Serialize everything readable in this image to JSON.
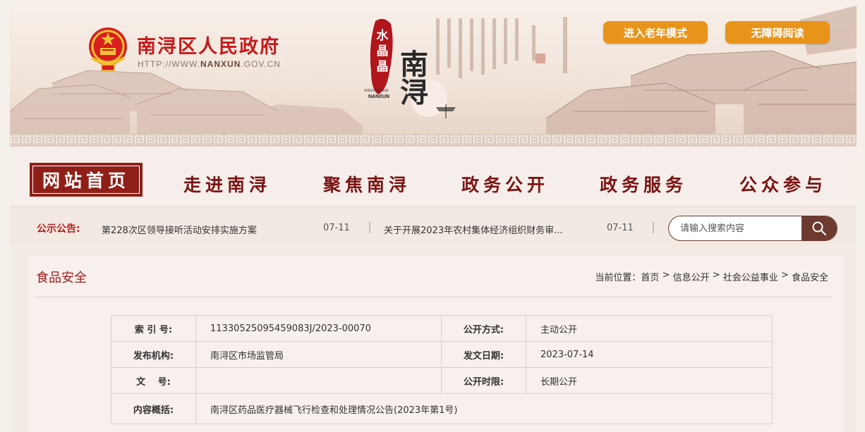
{
  "header": {
    "site_title": "南浔区人民政府",
    "site_url_prefix": "HTTP://WWW.",
    "site_url_domain": "NANXUN",
    "site_url_suffix": ".GOV.CN",
    "logo_top": "水晶晶",
    "logo_pinyin_1": "SHUIJINGJING",
    "logo_pinyin_2": "NANXUN",
    "logo_big": "南浔",
    "elder_mode_button": "进入老年模式",
    "accessible_button": "无障碍阅读"
  },
  "nav": {
    "items": [
      {
        "label": "网站首页"
      },
      {
        "label": "走进南浔"
      },
      {
        "label": "聚焦南浔"
      },
      {
        "label": "政务公开"
      },
      {
        "label": "政务服务"
      },
      {
        "label": "公众参与"
      }
    ]
  },
  "notice": {
    "label": "公示公告:",
    "items": [
      {
        "title": "第228次区领导接听活动安排实施方案",
        "date": "07-11"
      },
      {
        "title": "关于开展2023年农村集体经济组织财务审...",
        "date": "07-11"
      }
    ],
    "search_placeholder": "请输入搜索内容"
  },
  "content": {
    "section_title": "食品安全",
    "breadcrumb_prefix": "当前位置：",
    "breadcrumb": [
      "首页",
      "信息公开",
      "社会公益事业",
      "食品安全"
    ],
    "breadcrumb_sep": " > "
  },
  "info_table": {
    "index_no_label": "索 引 号:",
    "index_no": "11330525095459083J/2023-00070",
    "publish_mode_label": "公开方式:",
    "publish_mode": "主动公开",
    "publisher_label": "发布机构:",
    "publisher": "南浔区市场监管局",
    "issue_date_label": "发文日期:",
    "issue_date": "2023-07-14",
    "doc_no_label": "文　 号:",
    "doc_no": "",
    "publish_period_label": "公开时限:",
    "publish_period": "长期公开",
    "summary_label": "内容概括:",
    "summary": "南浔区药品医疗器械飞行检查和处理情况公告(2023年第1号)"
  },
  "colors": {
    "accent_red": "#b51c1c",
    "nav_active_bg": "#8f1f18",
    "button_orange": "#e8941a",
    "search_button": "#6d3a30"
  }
}
